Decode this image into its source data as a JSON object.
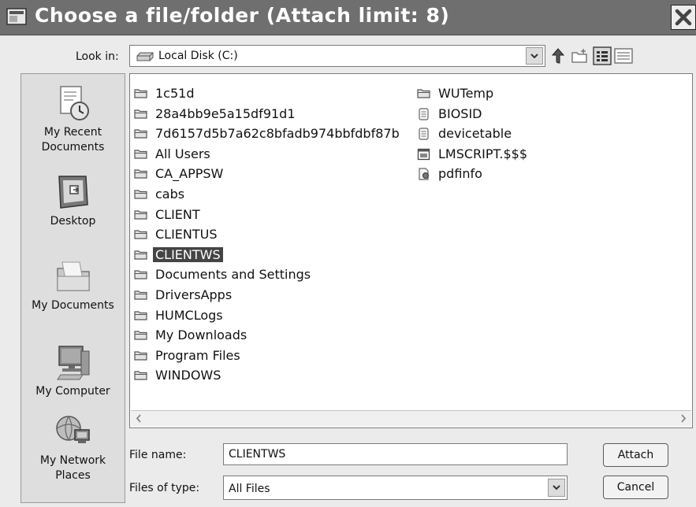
{
  "window": {
    "title": "Choose a file/folder  (Attach limit: 8)"
  },
  "look_in": {
    "label": "Look in:",
    "value": "Local Disk (C:)"
  },
  "places": [
    {
      "label1": "My Recent",
      "label2": "Documents"
    },
    {
      "label1": "Desktop",
      "label2": ""
    },
    {
      "label1": "My Documents",
      "label2": ""
    },
    {
      "label1": "My Computer",
      "label2": ""
    },
    {
      "label1": "My Network",
      "label2": "Places"
    }
  ],
  "files_col1": [
    {
      "name": "1c51d",
      "type": "folder"
    },
    {
      "name": "28a4bb9e5a15df91d1",
      "type": "folder"
    },
    {
      "name": "7d6157d5b7a62c8bfadb974bbfdbf87b",
      "type": "folder"
    },
    {
      "name": "All Users",
      "type": "folder"
    },
    {
      "name": "CA_APPSW",
      "type": "folder"
    },
    {
      "name": "cabs",
      "type": "folder"
    },
    {
      "name": "CLIENT",
      "type": "folder"
    },
    {
      "name": "CLIENTUS",
      "type": "folder"
    },
    {
      "name": "CLIENTWS",
      "type": "folder",
      "selected": true
    },
    {
      "name": "Documents and Settings",
      "type": "folder"
    },
    {
      "name": "DriversApps",
      "type": "folder"
    },
    {
      "name": "HUMCLogs",
      "type": "folder"
    },
    {
      "name": "My Downloads",
      "type": "folder"
    },
    {
      "name": "Program Files",
      "type": "folder"
    },
    {
      "name": "WINDOWS",
      "type": "folder"
    }
  ],
  "files_col2": [
    {
      "name": "WUTemp",
      "type": "folder"
    },
    {
      "name": "BIOSID",
      "type": "document"
    },
    {
      "name": "devicetable",
      "type": "document"
    },
    {
      "name": "LMSCRIPT.$$$",
      "type": "system"
    },
    {
      "name": "pdfinfo",
      "type": "script"
    }
  ],
  "file_name": {
    "label": "File name:",
    "value": "CLIENTWS"
  },
  "file_type": {
    "label": "Files of type:",
    "value": "All Files"
  },
  "buttons": {
    "attach": "Attach",
    "cancel": "Cancel"
  }
}
